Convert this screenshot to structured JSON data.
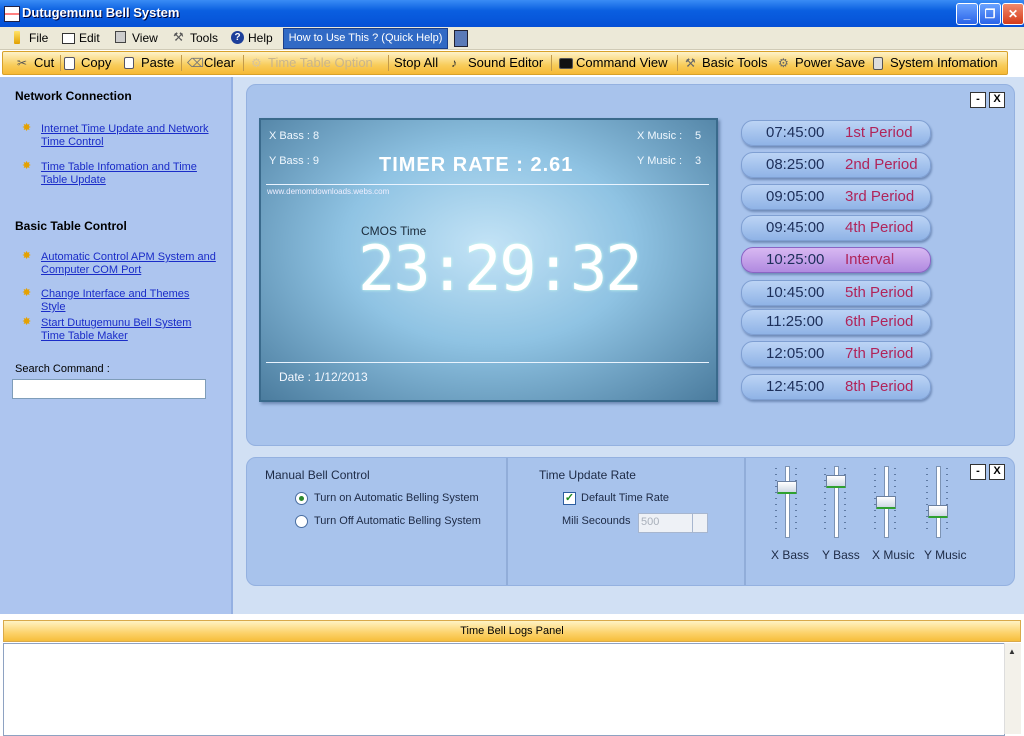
{
  "window": {
    "title": "Dutugemunu Bell System"
  },
  "menu": {
    "items": [
      {
        "label": "File",
        "icon": "file-icon"
      },
      {
        "label": "Edit",
        "icon": "edit-icon"
      },
      {
        "label": "View",
        "icon": "view-icon"
      },
      {
        "label": "Tools",
        "icon": "tools-icon"
      },
      {
        "label": "Help",
        "icon": "help-icon"
      }
    ],
    "quick_help": "How to Use This ? (Quick Help)"
  },
  "toolbar": {
    "cut": "Cut",
    "copy": "Copy",
    "paste": "Paste",
    "clear": "Clear",
    "timetable": "Time Table Option",
    "stop_all": "Stop All",
    "sound_editor": "Sound Editor",
    "command_view": "Command View",
    "basic_tools": "Basic Tools",
    "power_save": "Power Save",
    "system_info": "System Infomation"
  },
  "sidebar": {
    "network_heading": "Network Connection",
    "network_links": [
      "Internet Time Update and Network Time Control",
      "Time Table Infomation and Time Table Update"
    ],
    "basic_heading": "Basic Table Control",
    "basic_links": [
      "Automatic Control APM System and Computer COM Port",
      "Change Interface and Themes Style",
      "Start Dutugemunu Bell System Time Table Maker"
    ],
    "search_label": "Search Command :",
    "search_value": ""
  },
  "display": {
    "xbass": "X Bass :  8",
    "ybass": "Y Bass :  9",
    "xmusic_label": "X Music :",
    "xmusic_value": "5",
    "ymusic_label": "Y Music :",
    "ymusic_value": "3",
    "timer_rate": "TIMER RATE :  2.61",
    "site": "www.demomdownloads.webs.com",
    "cmos_label": "CMOS Time",
    "clock": "23:29:32",
    "date": "Date : 1/12/2013"
  },
  "periods": [
    {
      "time": "07:45:00",
      "label": "1st Period"
    },
    {
      "time": "08:25:00",
      "label": "2nd Period"
    },
    {
      "time": "09:05:00",
      "label": "3rd Period"
    },
    {
      "time": "09:45:00",
      "label": "4th Period"
    },
    {
      "time": "10:25:00",
      "label": "Interval"
    },
    {
      "time": "10:45:00",
      "label": "5th Period"
    },
    {
      "time": "11:25:00",
      "label": "6th Period"
    },
    {
      "time": "12:05:00",
      "label": "7th Period"
    },
    {
      "time": "12:45:00",
      "label": "8th Period"
    }
  ],
  "active_period_index": 4,
  "manual": {
    "title": "Manual Bell Control",
    "on_label": "Turn on Automatic Belling System",
    "off_label": "Turn Off Automatic Belling System",
    "selected": "on"
  },
  "time_update": {
    "title": "Time Update Rate",
    "default_label": "Default Time Rate",
    "default_checked": true,
    "mili_label": "Mili Secounds",
    "mili_value": "500"
  },
  "sliders": [
    {
      "label": "X Bass",
      "level": 0.75
    },
    {
      "label": "Y Bass",
      "level": 0.85
    },
    {
      "label": "X Music",
      "level": 0.5
    },
    {
      "label": "Y Music",
      "level": 0.35
    }
  ],
  "logs": {
    "title": "Time Bell Logs Panel"
  },
  "panel_buttons": {
    "minimize": "-",
    "close": "X"
  }
}
